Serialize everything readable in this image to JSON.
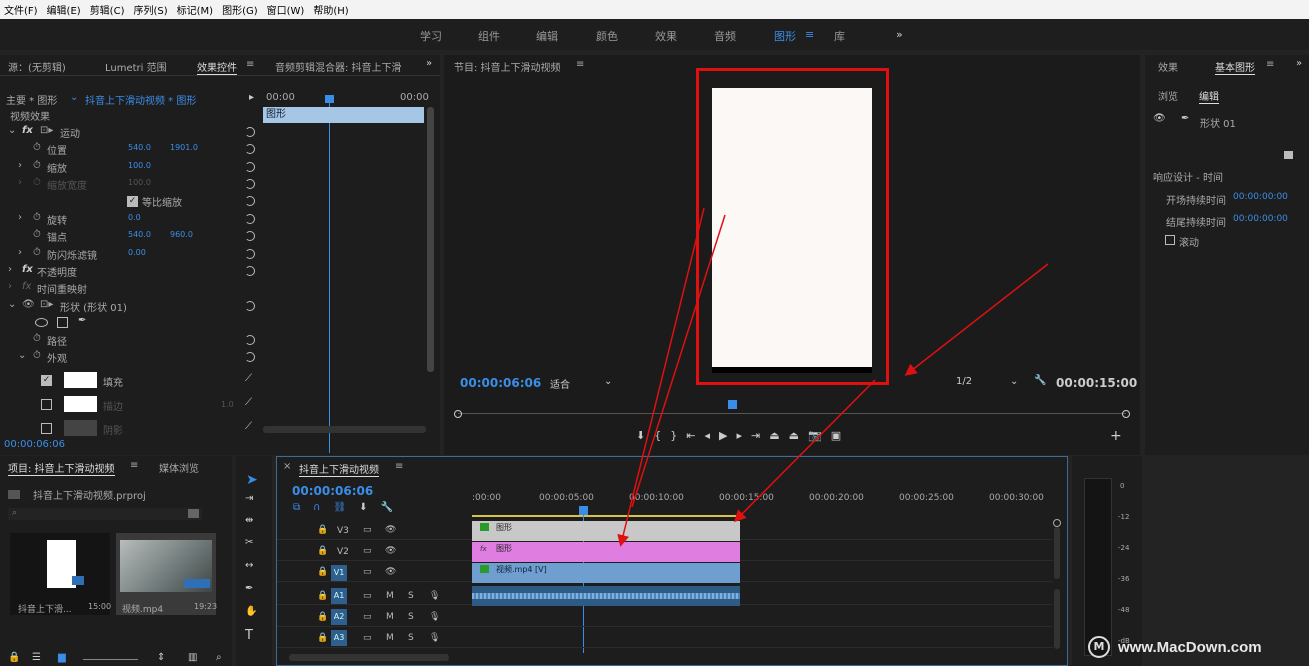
{
  "menu": [
    "文件(F)",
    "编辑(E)",
    "剪辑(C)",
    "序列(S)",
    "标记(M)",
    "图形(G)",
    "窗口(W)",
    "帮助(H)"
  ],
  "workspaces": [
    "学习",
    "组件",
    "编辑",
    "颜色",
    "效果",
    "音频",
    "图形",
    "库"
  ],
  "workspace_more": "»",
  "left_tabs": {
    "source": "源：(无剪辑)",
    "lumetri": "Lumetri 范围",
    "effect_controls": "效果控件",
    "audio_mixer": "音频剪辑混合器: 抖音上下滑"
  },
  "ec": {
    "master": "主要 * 图形",
    "seq": "抖音上下滑动视频 * 图形",
    "ruler_start": "00:00",
    "ruler_end": "00:00",
    "clip_label": "图形",
    "video_effects": "视频效果",
    "motion": "运动",
    "position": "位置",
    "pos_x": "540.0",
    "pos_y": "1901.0",
    "scale": "缩放",
    "scale_v": "100.0",
    "scale_w": "缩放宽度",
    "scale_w_v": "100.0",
    "uniform": "等比缩放",
    "rotation": "旋转",
    "rotation_v": "0.0",
    "anchor": "锚点",
    "anchor_x": "540.0",
    "anchor_y": "960.0",
    "flicker": "防闪烁滤镜",
    "flicker_v": "0.00",
    "opacity": "不透明度",
    "remap": "时间重映射",
    "shape": "形状 (形状 01)",
    "path": "路径",
    "appearance": "外观",
    "fill": "填充",
    "stroke": "描边",
    "stroke_v": "1.0",
    "shadow": "阴影",
    "time": "00:00:06:06"
  },
  "program": {
    "title": "节目: 抖音上下滑动视频",
    "timecode": "00:00:06:06",
    "fit": "适合",
    "res": "1/2",
    "duration": "00:00:15:00"
  },
  "right": {
    "tab1": "效果",
    "tab2": "基本图形",
    "sub1": "浏览",
    "sub2": "编辑",
    "layer": "形状 01",
    "resp": "响应设计 - 时间",
    "intro": "开场持续时间",
    "intro_v": "00:00:00:00",
    "outro": "结尾持续时间",
    "outro_v": "00:00:00:00",
    "roll": "滚动"
  },
  "project": {
    "tab": "项目: 抖音上下滑动视频",
    "media": "媒体浏览",
    "file": "抖音上下滑动视频.prproj",
    "item1": "抖音上下滑...",
    "item1_d": "15:00",
    "item2": "视频.mp4",
    "item2_d": "19:23"
  },
  "timeline": {
    "tab": "抖音上下滑动视频",
    "timecode": "00:00:06:06",
    "ruler": [
      ":00:00",
      "00:00:05:00",
      "00:00:10:00",
      "00:00:15:00",
      "00:00:20:00",
      "00:00:25:00",
      "00:00:30:00"
    ],
    "tracks": [
      "V3",
      "V2",
      "V1",
      "A1",
      "A2",
      "A3"
    ],
    "clip_v3": "图形",
    "clip_v2": "图形",
    "clip_v1": "视频.mp4 [V]"
  },
  "meter": [
    "0",
    "-12",
    "-24",
    "-36",
    "-48",
    "-dB"
  ],
  "watermark": "www.MacDown.com",
  "colors": {
    "accent": "#3b8ee8",
    "red": "#e01010",
    "v3": "#c8c8c8",
    "v2": "#e07de0",
    "v1": "#6f9fd0",
    "audio": "#4c84b6"
  }
}
